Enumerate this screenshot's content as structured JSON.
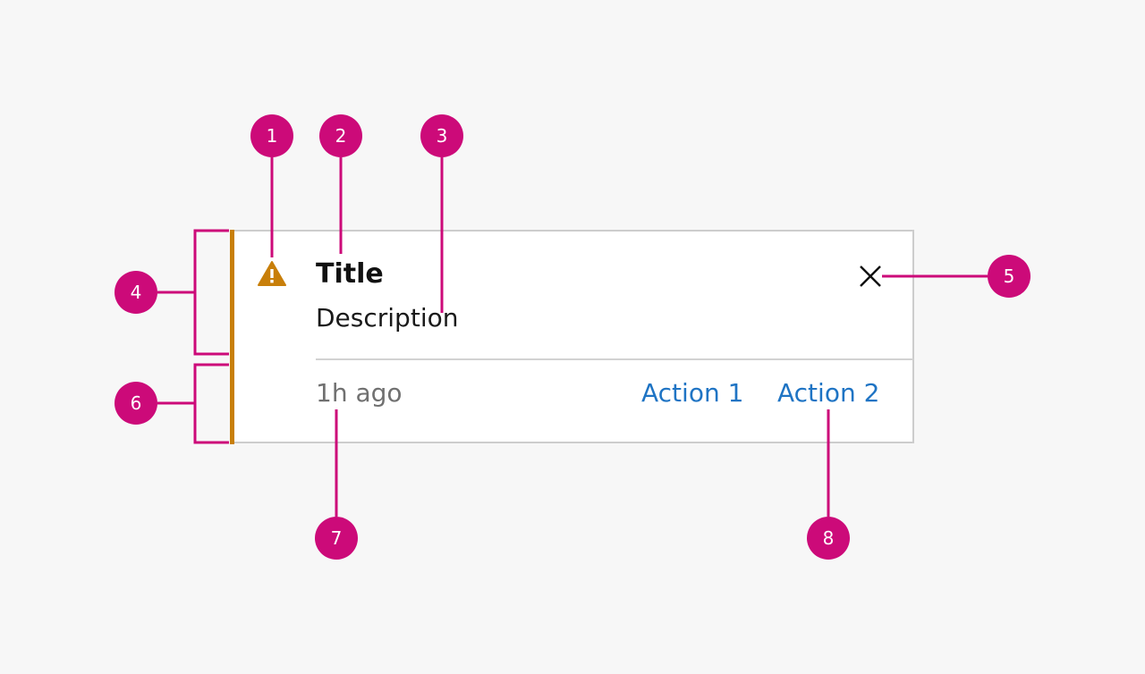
{
  "colors": {
    "background": "#f7f7f7",
    "accent": "#c87f0a",
    "annotation": "#cc0a79",
    "link": "#1f74c4",
    "muted": "#707070"
  },
  "notification": {
    "icon": "warning-icon",
    "title": "Title",
    "description": "Description",
    "close_icon": "close-icon",
    "timestamp": "1h ago",
    "actions": [
      {
        "label": "Action 1"
      },
      {
        "label": "Action 2"
      }
    ]
  },
  "annotations": [
    "1",
    "2",
    "3",
    "4",
    "5",
    "6",
    "7",
    "8"
  ]
}
